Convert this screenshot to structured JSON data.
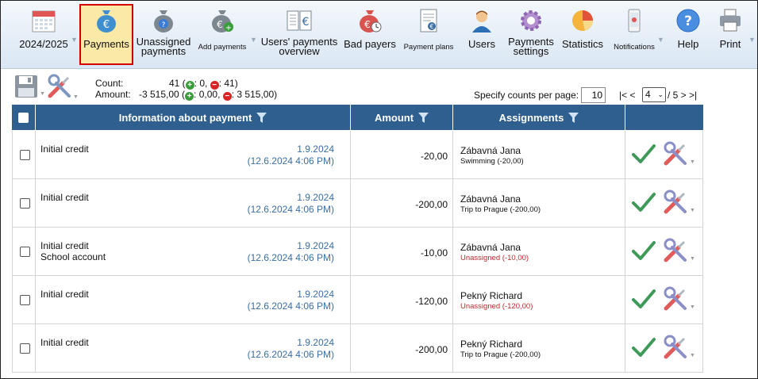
{
  "toolbar": {
    "items": [
      {
        "label": "2024/2025",
        "icon": "calendar-icon"
      },
      {
        "label": "Payments",
        "icon": "money-bag-euro-icon"
      },
      {
        "label": "Unassigned\npayments",
        "icon": "money-bag-question-icon"
      },
      {
        "label": "Add payments",
        "icon": "money-bag-add-icon"
      },
      {
        "label": "Users' payments\noverview",
        "icon": "ledger-euro-icon"
      },
      {
        "label": "Bad payers",
        "icon": "money-bag-clock-icon"
      },
      {
        "label": "Payment plans",
        "icon": "document-euro-icon"
      },
      {
        "label": "Users",
        "icon": "user-icon"
      },
      {
        "label": "Payments\nsettings",
        "icon": "gear-icon"
      },
      {
        "label": "Statistics",
        "icon": "pie-chart-icon"
      },
      {
        "label": "Notifications",
        "icon": "phone-icon"
      },
      {
        "label": "Help",
        "icon": "help-icon"
      },
      {
        "label": "Print",
        "icon": "printer-icon"
      }
    ]
  },
  "summary": {
    "count_label": "Count:",
    "count_value": "41 (",
    "count_plus": ": 0, ",
    "count_minus": ": 41)",
    "amount_label": "Amount:",
    "amount_value": "-3 515,00 (",
    "amount_plus": ": 0,00, ",
    "amount_minus": ": 3 515,00)"
  },
  "pagination": {
    "per_page_label": "Specify counts per page:",
    "per_page_value": "10",
    "nav_prev": "|< <",
    "current_page": "4",
    "total": "/ 5  > >|"
  },
  "table": {
    "columns": [
      "Information about payment",
      "Amount",
      "Assignments"
    ],
    "rows": [
      {
        "info": "Initial credit",
        "info2": "",
        "date": "1.9.2024",
        "datetime": "(12.6.2024 4:06 PM)",
        "amount": "-20,00",
        "name": "Zábavná Jana",
        "assignment": "Swimming (-20,00)",
        "unassigned": false
      },
      {
        "info": "Initial credit",
        "info2": "",
        "date": "1.9.2024",
        "datetime": "(12.6.2024 4:06 PM)",
        "amount": "-200,00",
        "name": "Zábavná Jana",
        "assignment": "Trip to Prague (-200,00)",
        "unassigned": false
      },
      {
        "info": "Initial credit",
        "info2": "School account",
        "date": "1.9.2024",
        "datetime": "(12.6.2024 4:06 PM)",
        "amount": "-10,00",
        "name": "Zábavná Jana",
        "assignment": "Unassigned (-10,00)",
        "unassigned": true
      },
      {
        "info": "Initial credit",
        "info2": "",
        "date": "1.9.2024",
        "datetime": "(12.6.2024 4:06 PM)",
        "amount": "-120,00",
        "name": "Pekný Richard",
        "assignment": "Unassigned (-120,00)",
        "unassigned": true
      },
      {
        "info": "Initial credit",
        "info2": "",
        "date": "1.9.2024",
        "datetime": "(12.6.2024 4:06 PM)",
        "amount": "-200,00",
        "name": "Pekný Richard",
        "assignment": "Trip to Prague (-200,00)",
        "unassigned": false
      }
    ]
  },
  "colors": {
    "header_bg": "#2e5f8e",
    "link_blue": "#3a6ea5",
    "unassigned_red": "#c0282d",
    "active_tab_bg": "#fbe9a8",
    "active_tab_border": "#d40000"
  }
}
